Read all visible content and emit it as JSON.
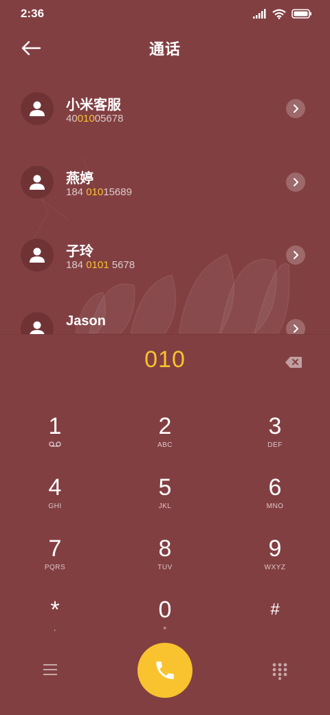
{
  "status_bar": {
    "time": "2:36"
  },
  "header": {
    "title": "通话"
  },
  "contacts": [
    {
      "name": "小米客服",
      "number_parts": [
        {
          "text": "40",
          "highlight": false
        },
        {
          "text": "010",
          "highlight": true
        },
        {
          "text": "05678",
          "highlight": false
        }
      ]
    },
    {
      "name": "燕婷",
      "number_parts": [
        {
          "text": "184 ",
          "highlight": false
        },
        {
          "text": "010",
          "highlight": true
        },
        {
          "text": "15689",
          "highlight": false
        }
      ]
    },
    {
      "name": "子玲",
      "number_parts": [
        {
          "text": "184 ",
          "highlight": false
        },
        {
          "text": "0101",
          "highlight": true
        },
        {
          "text": " 5678",
          "highlight": false
        }
      ]
    },
    {
      "name": "Jason",
      "number_parts": []
    }
  ],
  "dial_entry": {
    "value": "010"
  },
  "keypad": [
    {
      "digit": "1",
      "letters": ""
    },
    {
      "digit": "2",
      "letters": "ABC"
    },
    {
      "digit": "3",
      "letters": "DEF"
    },
    {
      "digit": "4",
      "letters": "GHI"
    },
    {
      "digit": "5",
      "letters": "JKL"
    },
    {
      "digit": "6",
      "letters": "MNO"
    },
    {
      "digit": "7",
      "letters": "PQRS"
    },
    {
      "digit": "8",
      "letters": "TUV"
    },
    {
      "digit": "9",
      "letters": "WXYZ"
    },
    {
      "digit": "*",
      "letters": ","
    },
    {
      "digit": "0",
      "letters": "+"
    },
    {
      "digit": "#",
      "letters": ""
    }
  ],
  "colors": {
    "background": "#823f42",
    "accent": "#f8c32e",
    "text": "#ffffff"
  },
  "icons": {
    "back": "arrow-left-icon",
    "avatar": "person-icon",
    "chevron": "chevron-right-icon",
    "backspace": "backspace-icon",
    "voicemail": "voicemail-icon",
    "menu": "menu-icon",
    "call": "phone-icon",
    "dialpad": "dialpad-icon"
  }
}
